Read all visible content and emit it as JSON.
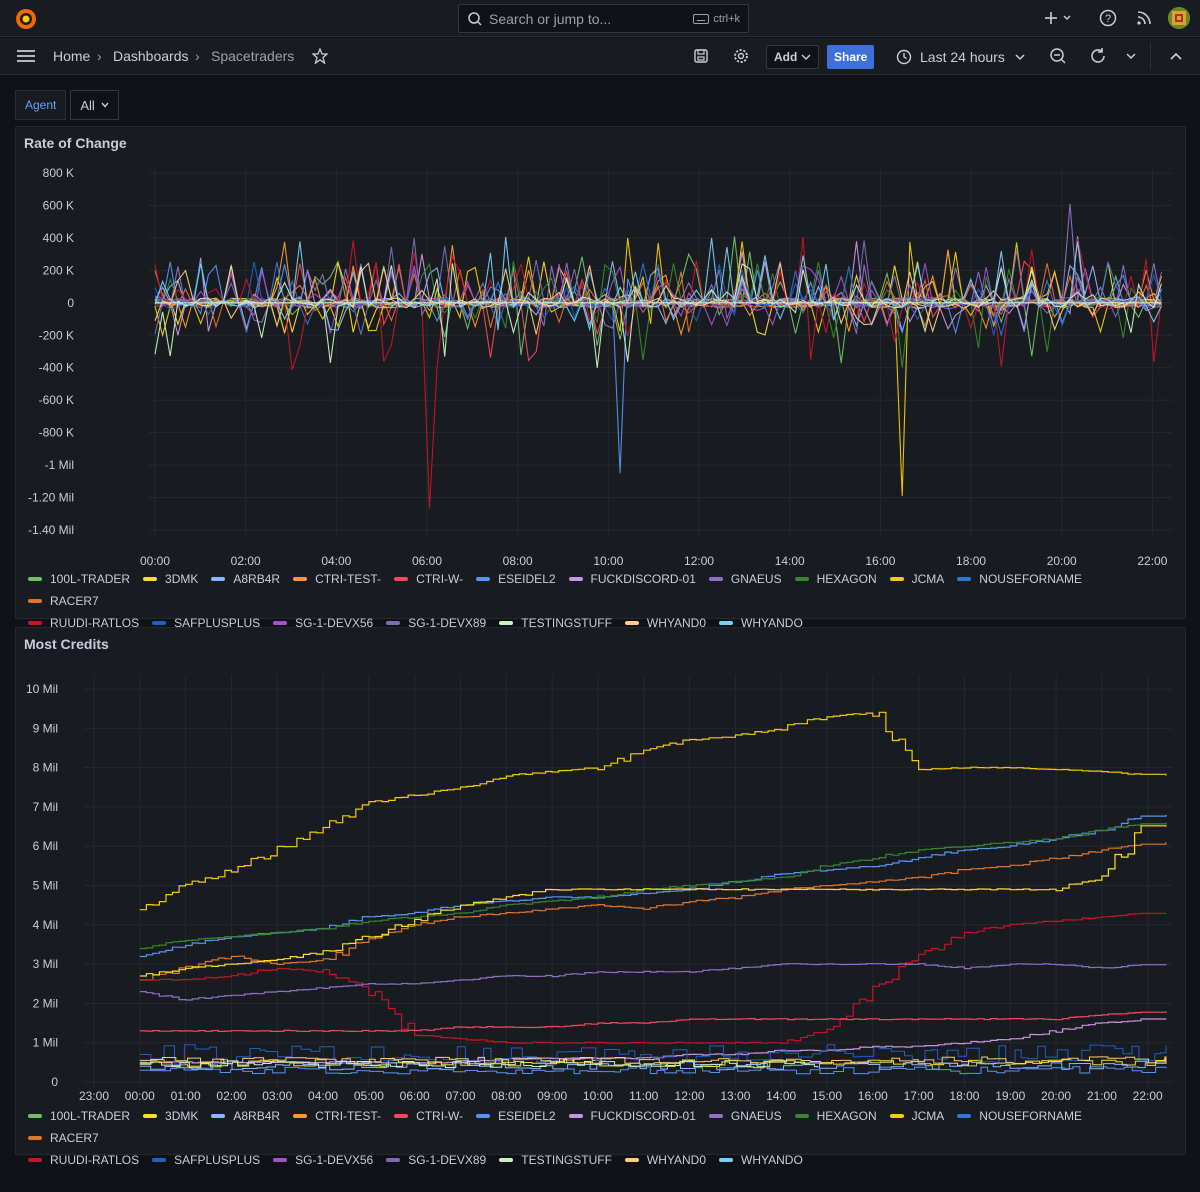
{
  "topbar": {
    "search_placeholder": "Search or jump to...",
    "search_shortcut": "ctrl+k"
  },
  "breadcrumb": {
    "home": "Home",
    "dashboards": "Dashboards",
    "current": "Spacetraders"
  },
  "toolbar": {
    "add_label": "Add",
    "share_label": "Share",
    "time_range": "Last 24 hours"
  },
  "variables": {
    "agent_label": "Agent",
    "agent_value": "All"
  },
  "legend": [
    {
      "name": "100L-TRADER",
      "color": "#73bf69"
    },
    {
      "name": "3DMK",
      "color": "#fade2a"
    },
    {
      "name": "A8RB4R",
      "color": "#8ab8ff"
    },
    {
      "name": "CTRI-TEST-",
      "color": "#ff9830"
    },
    {
      "name": "CTRI-W-",
      "color": "#f2495c"
    },
    {
      "name": "ESEIDEL2",
      "color": "#5794f2"
    },
    {
      "name": "FUCKDISCORD-01",
      "color": "#ca95e5"
    },
    {
      "name": "GNAEUS",
      "color": "#8f70c9"
    },
    {
      "name": "HEXAGON",
      "color": "#37872d"
    },
    {
      "name": "JCMA",
      "color": "#f2cc0c"
    },
    {
      "name": "NOUSEFORNAME",
      "color": "#3274d9"
    },
    {
      "name": "RACER7",
      "color": "#e0752d"
    },
    {
      "name": "RUUDI-RATLOS",
      "color": "#c4162a"
    },
    {
      "name": "SAFPLUSPLUS",
      "color": "#1f60c4"
    },
    {
      "name": "SG-1-DEVX56",
      "color": "#a352cc"
    },
    {
      "name": "SG-1-DEVX89",
      "color": "#7d6bb5"
    },
    {
      "name": "TESTINGSTUFF",
      "color": "#c8f2c2"
    },
    {
      "name": "WHYAND0",
      "color": "#ffcb7d"
    },
    {
      "name": "WHYANDO",
      "color": "#73d2f0"
    }
  ],
  "panels": {
    "rate": {
      "title": "Rate of Change",
      "y_ticks": [
        "800 K",
        "600 K",
        "400 K",
        "200 K",
        "0",
        "-200 K",
        "-400 K",
        "-600 K",
        "-800 K",
        "-1 Mil",
        "-1.20 Mil",
        "-1.40 Mil"
      ],
      "x_ticks": [
        "00:00",
        "02:00",
        "04:00",
        "06:00",
        "08:00",
        "10:00",
        "12:00",
        "14:00",
        "16:00",
        "18:00",
        "20:00",
        "22:00"
      ]
    },
    "credits": {
      "title": "Most Credits",
      "y_ticks": [
        "10 Mil",
        "9 Mil",
        "8 Mil",
        "7 Mil",
        "6 Mil",
        "5 Mil",
        "4 Mil",
        "3 Mil",
        "2 Mil",
        "1 Mil",
        "0"
      ],
      "x_ticks": [
        "23:00",
        "00:00",
        "01:00",
        "02:00",
        "03:00",
        "04:00",
        "05:00",
        "06:00",
        "07:00",
        "08:00",
        "09:00",
        "10:00",
        "11:00",
        "12:00",
        "13:00",
        "14:00",
        "15:00",
        "16:00",
        "17:00",
        "18:00",
        "19:00",
        "20:00",
        "21:00",
        "22:00"
      ]
    }
  },
  "chart_data": [
    {
      "type": "line",
      "title": "Rate of Change",
      "ylim": [
        -1400000,
        800000
      ],
      "x_range": [
        "00:00",
        "22:00"
      ],
      "series": [
        {
          "name": "JCMA",
          "x": [
            "16:30"
          ],
          "values": [
            -1190000
          ]
        },
        {
          "name": "RUUDI-RATLOS",
          "x": [
            "06:00"
          ],
          "values": [
            -1270000
          ]
        },
        {
          "name": "ESEIDEL2",
          "x": [
            "10:20"
          ],
          "values": [
            -1050000
          ]
        },
        {
          "name": "GNAEUS",
          "x": [
            "20:10"
          ],
          "values": [
            610000
          ]
        }
      ]
    },
    {
      "type": "line",
      "title": "Most Credits",
      "ylim": [
        0,
        10000000
      ],
      "x": [
        "23:00",
        "00:00",
        "01:00",
        "02:00",
        "03:00",
        "04:00",
        "05:00",
        "06:00",
        "07:00",
        "08:00",
        "09:00",
        "10:00",
        "11:00",
        "12:00",
        "13:00",
        "14:00",
        "15:00",
        "16:00",
        "17:00",
        "18:00",
        "19:00",
        "20:00",
        "21:00",
        "22:00"
      ],
      "series": [
        {
          "name": "JCMA",
          "values": [
            null,
            4400000,
            5000000,
            5400000,
            5900000,
            6500000,
            7100000,
            7300000,
            7500000,
            7800000,
            7900000,
            8000000,
            8400000,
            8700000,
            8800000,
            9000000,
            9300000,
            9400000,
            7950000,
            8000000,
            8000000,
            7950000,
            7900000,
            7800000
          ]
        },
        {
          "name": "ESEIDEL2",
          "values": [
            null,
            3200000,
            3500000,
            3700000,
            3800000,
            3900000,
            4200000,
            4300000,
            4500000,
            4600000,
            4700000,
            4700000,
            4800000,
            4900000,
            5100000,
            5300000,
            5400000,
            5500000,
            5700000,
            5900000,
            6000000,
            6200000,
            6400000,
            6800000
          ]
        },
        {
          "name": "HEXAGON",
          "values": [
            null,
            3400000,
            3600000,
            3700000,
            3800000,
            3900000,
            4100000,
            4200000,
            4300000,
            4500000,
            4600000,
            4700000,
            4900000,
            5000000,
            5100000,
            5200000,
            5500000,
            5700000,
            5900000,
            6000000,
            6100000,
            6200000,
            6400000,
            6600000
          ]
        },
        {
          "name": "RACER7",
          "values": [
            null,
            2600000,
            2900000,
            3200000,
            3000000,
            3100000,
            3600000,
            4000000,
            4200000,
            4300000,
            4400000,
            4500000,
            4400000,
            4600000,
            4700000,
            4900000,
            5000000,
            5100000,
            5200000,
            5400000,
            5500000,
            5700000,
            5900000,
            6100000
          ]
        },
        {
          "name": "3DMK",
          "values": [
            null,
            2700000,
            2900000,
            3000000,
            3100000,
            3300000,
            3700000,
            4100000,
            4500000,
            4700000,
            4900000,
            4900000,
            4900000,
            4900000,
            4900000,
            4900000,
            4900000,
            4900000,
            4900000,
            4900000,
            4900000,
            4900000,
            5200000,
            6500000
          ]
        },
        {
          "name": "RUUDI-RATLOS",
          "values": [
            null,
            2600000,
            2600000,
            2700000,
            2900000,
            2800000,
            2400000,
            1200000,
            1100000,
            1000000,
            1000000,
            1000000,
            1000000,
            1000000,
            1000000,
            1000000,
            1300000,
            2300000,
            3200000,
            3800000,
            4000000,
            4100000,
            4200000,
            4300000
          ]
        },
        {
          "name": "GNAEUS",
          "values": [
            null,
            2300000,
            2100000,
            2200000,
            2300000,
            2400000,
            2500000,
            2500000,
            2600000,
            2700000,
            2700000,
            2800000,
            2800000,
            2800000,
            2900000,
            3000000,
            3000000,
            3000000,
            3000000,
            2900000,
            3000000,
            3000000,
            2900000,
            3000000
          ]
        },
        {
          "name": "CTRI-W-",
          "values": [
            null,
            1300000,
            1300000,
            1300000,
            1300000,
            1300000,
            1300000,
            1300000,
            1400000,
            1400000,
            1400000,
            1500000,
            1500000,
            1600000,
            1600000,
            1600000,
            1600000,
            1600000,
            1600000,
            1600000,
            1600000,
            1600000,
            1700000,
            1800000
          ]
        },
        {
          "name": "FUCKDISCORD-01",
          "values": [
            null,
            500000,
            500000,
            500000,
            500000,
            500000,
            500000,
            500000,
            500000,
            600000,
            600000,
            600000,
            600000,
            700000,
            700000,
            800000,
            800000,
            900000,
            900000,
            1000000,
            1100000,
            1300000,
            1500000,
            1600000
          ]
        }
      ]
    }
  ]
}
